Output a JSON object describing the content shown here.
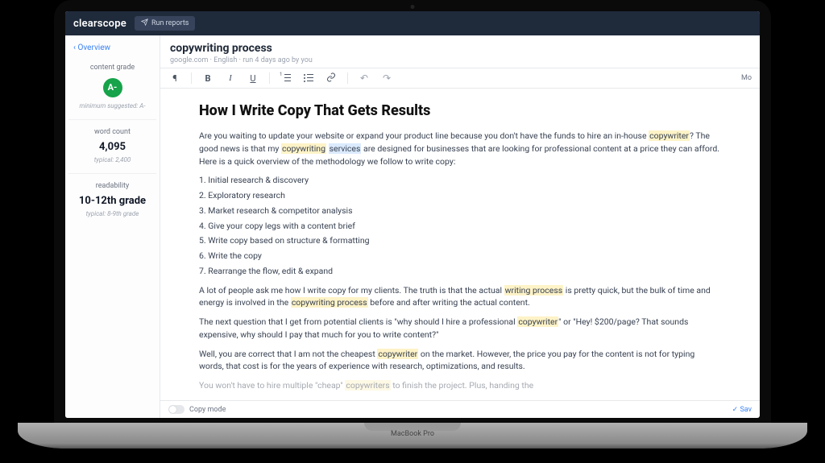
{
  "brand": "clearscope",
  "header": {
    "run_reports_label": "Run reports"
  },
  "sidebar": {
    "overview_label": "Overview",
    "grade": {
      "label": "content grade",
      "value": "A-",
      "sub": "minimum suggested: A-"
    },
    "wordcount": {
      "label": "word count",
      "value": "4,095",
      "sub": "typical: 2,400"
    },
    "readability": {
      "label": "readability",
      "value": "10-12th grade",
      "sub": "typical: 8-9th grade"
    }
  },
  "doc": {
    "title": "copywriting process",
    "meta": "google.com · English · run 4 days ago by you"
  },
  "toolbar": {
    "paragraph": "¶",
    "bold": "B",
    "italic": "I",
    "underline": "U",
    "link": "🔗",
    "more": "Mo"
  },
  "article": {
    "heading": "How I Write Copy That Gets Results",
    "p1_a": "Are you waiting to update your website or expand your product line because you don't have the funds to hire an in-house ",
    "p1_hl1": "copywriter",
    "p1_b": "? The good news is that my ",
    "p1_hl2": "copywriting",
    "p1_c": " ",
    "p1_hl3": "services",
    "p1_d": " are designed for businesses that are looking for professional content at a price they can afford. Here is a quick overview of the methodology we follow to write copy:",
    "list": [
      "1. Initial research & discovery",
      "2. Exploratory research",
      "3. Market research & competitor analysis",
      "4. Give your copy legs with a content brief",
      "5. Write copy based on structure & formatting",
      "6. Write the copy",
      "7. Rearrange the flow, edit & expand"
    ],
    "p2_a": "A lot of people ask me how I write copy for my clients. The truth is that the actual ",
    "p2_hl1": "writing process",
    "p2_b": " is pretty quick, but the bulk of time and energy is involved in the ",
    "p2_hl2": "copywriting process",
    "p2_c": " before and after writing the actual content.",
    "p3_a": "The next question that I get from potential clients is \"why should I hire a professional ",
    "p3_hl1": "copywriter",
    "p3_b": "\" or \"Hey! $200/page? That sounds expensive, why should I pay that much for you to write content?\"",
    "p4_a": "Well, you are correct that I am not the cheapest ",
    "p4_hl1": "copywriter",
    "p4_b": " on the market. However, the price you pay for the content is not for typing words, that cost is for the years of experience with research, optimizations, and results.",
    "p5_a": "You won't have to hire multiple \"cheap\" ",
    "p5_hl1": "copywriters",
    "p5_b": " to finish the project. Plus, handing the"
  },
  "footer": {
    "copy_mode": "Copy mode",
    "save": "Sav"
  },
  "device_label": "MacBook Pro"
}
